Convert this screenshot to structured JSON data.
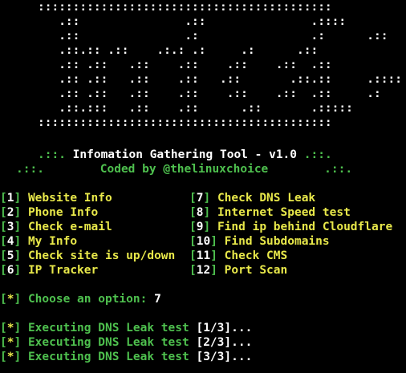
{
  "ascii_banner": [
    "::::::::::::::::::::::::::::::::::::::::::",
    "   .::               .::               .::::",
    "   .::               .:                .:      .::",
    "   .::.:: .::    .:.: .:     .:      .::",
    "   .:: .::   .::    .::    .::    .::  .::",
    "   .:: .::   .::    .::   .::       .::.::     .::::",
    "   .:: .::   .::    .::    .::    .::  .::     .:",
    "   .::.:::   .::    .::      .::       .:::::",
    "::::::::::::::::::::::::::::::::::::::::::"
  ],
  "title": {
    "deco_left": ".::.",
    "text": "Infomation Gathering Tool - v1.0",
    "deco_right": ".::."
  },
  "credit": {
    "deco_left": ".::.",
    "text": "Coded by @thelinuxchoice",
    "deco_right": ".::."
  },
  "menu": {
    "left": [
      {
        "num": "1",
        "label": "Website Info"
      },
      {
        "num": "2",
        "label": "Phone Info"
      },
      {
        "num": "3",
        "label": "Check e-mail"
      },
      {
        "num": "4",
        "label": "My Info"
      },
      {
        "num": "5",
        "label": "Check site is up/down"
      },
      {
        "num": "6",
        "label": "IP Tracker"
      }
    ],
    "right": [
      {
        "num": "7",
        "label": "Check DNS Leak"
      },
      {
        "num": "8",
        "label": "Internet Speed test"
      },
      {
        "num": "9",
        "label": "Find ip behind Cloudflare"
      },
      {
        "num": "10",
        "label": "Find Subdomains"
      },
      {
        "num": "11",
        "label": "Check CMS"
      },
      {
        "num": "12",
        "label": "Port Scan"
      }
    ]
  },
  "prompt": {
    "marker": "*",
    "text": "Choose an option:",
    "value": "7"
  },
  "executing": [
    {
      "marker": "*",
      "text": "Executing DNS Leak test",
      "step": "[1/3]..."
    },
    {
      "marker": "*",
      "text": "Executing DNS Leak test",
      "step": "[2/3]..."
    },
    {
      "marker": "*",
      "text": "Executing DNS Leak test",
      "step": "[3/3]..."
    }
  ],
  "colors": {
    "background": "#000000",
    "green": "#4ec04e",
    "yellow": "#e8e84a",
    "white": "#ffffff"
  }
}
